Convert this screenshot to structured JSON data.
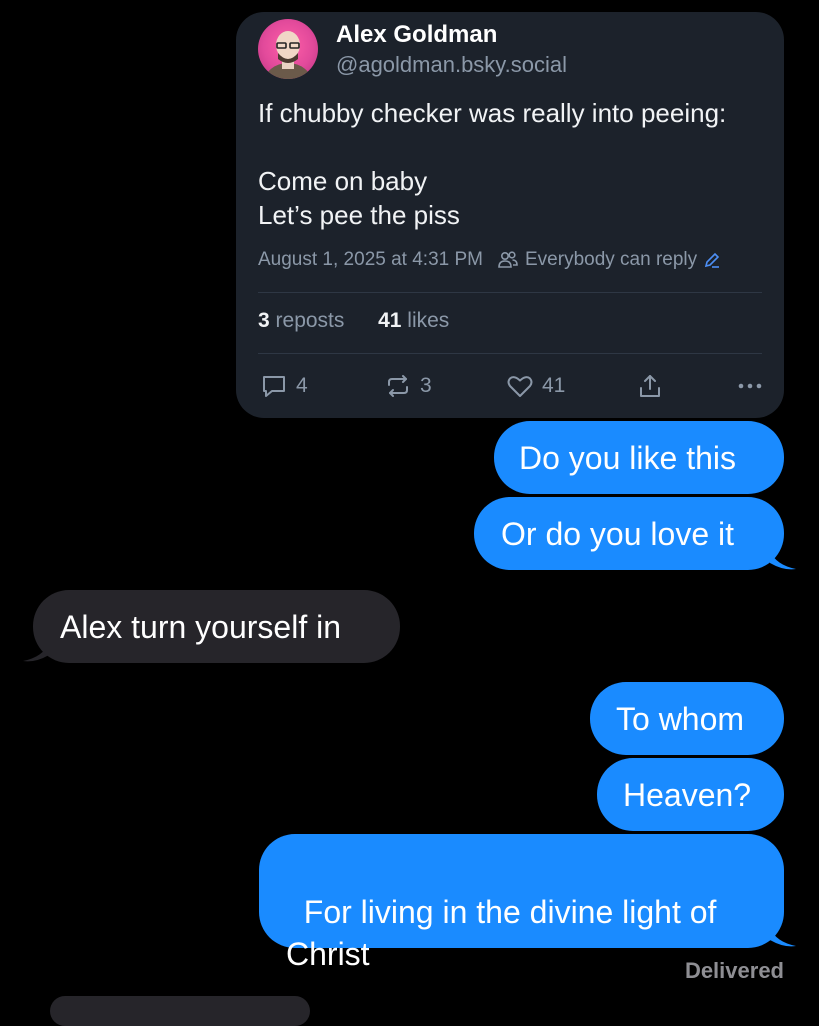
{
  "embed": {
    "author_name": "Alex Goldman",
    "author_handle": "@agoldman.bsky.social",
    "post_text": "If chubby checker was really into peeing:\n\nCome on baby\nLet’s pee the piss",
    "timestamp": "August 1, 2025 at 4:31 PM",
    "reply_setting": "Everybody can reply",
    "reposts_count": "3",
    "reposts_label": "reposts",
    "likes_count": "41",
    "likes_label": "likes",
    "actions": {
      "reply_count": "4",
      "repost_count": "3",
      "like_count": "41"
    }
  },
  "messages": [
    {
      "side": "sent",
      "text": "Do you like this"
    },
    {
      "side": "sent",
      "text": "Or do you love it"
    },
    {
      "side": "received",
      "text": "Alex turn yourself in"
    },
    {
      "side": "sent",
      "text": "To whom"
    },
    {
      "side": "sent",
      "text": "Heaven?"
    },
    {
      "side": "sent",
      "text": "For living in the divine light of\nChrist"
    }
  ],
  "status": "Delivered",
  "colors": {
    "sent_bubble": "#1a8bff",
    "received_bubble": "#26252a",
    "card_background": "#1c222b",
    "background": "#000000"
  }
}
